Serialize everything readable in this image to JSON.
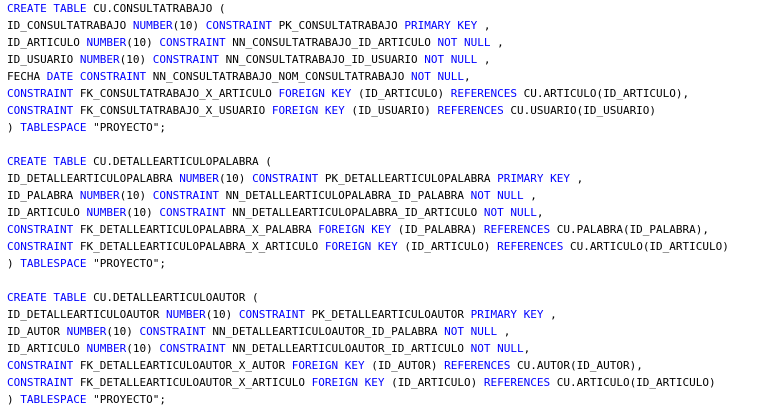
{
  "colors": {
    "background": "#ffffff",
    "keyword": "#0000ff",
    "text": "#000000"
  },
  "lines": [
    [
      {
        "k": 1,
        "t": "CREATE TABLE"
      },
      {
        "k": 0,
        "t": " CU.CONSULTATRABAJO ("
      }
    ],
    [
      {
        "k": 0,
        "t": "ID_CONSULTATRABAJO "
      },
      {
        "k": 1,
        "t": "NUMBER"
      },
      {
        "k": 0,
        "t": "(10) "
      },
      {
        "k": 1,
        "t": "CONSTRAINT"
      },
      {
        "k": 0,
        "t": " PK_CONSULTATRABAJO "
      },
      {
        "k": 1,
        "t": "PRIMARY KEY"
      },
      {
        "k": 0,
        "t": " ,"
      }
    ],
    [
      {
        "k": 0,
        "t": "ID_ARTICULO "
      },
      {
        "k": 1,
        "t": "NUMBER"
      },
      {
        "k": 0,
        "t": "(10) "
      },
      {
        "k": 1,
        "t": "CONSTRAINT"
      },
      {
        "k": 0,
        "t": " NN_CONSULTATRABAJO_ID_ARTICULO "
      },
      {
        "k": 1,
        "t": "NOT NULL"
      },
      {
        "k": 0,
        "t": " ,"
      }
    ],
    [
      {
        "k": 0,
        "t": "ID_USUARIO "
      },
      {
        "k": 1,
        "t": "NUMBER"
      },
      {
        "k": 0,
        "t": "(10) "
      },
      {
        "k": 1,
        "t": "CONSTRAINT"
      },
      {
        "k": 0,
        "t": " NN_CONSULTATRABAJO_ID_USUARIO "
      },
      {
        "k": 1,
        "t": "NOT NULL"
      },
      {
        "k": 0,
        "t": " ,"
      }
    ],
    [
      {
        "k": 0,
        "t": "FECHA "
      },
      {
        "k": 1,
        "t": "DATE CONSTRAINT"
      },
      {
        "k": 0,
        "t": " NN_CONSULTATRABAJO_NOM_CONSULTATRABAJO "
      },
      {
        "k": 1,
        "t": "NOT NULL"
      },
      {
        "k": 0,
        "t": ","
      }
    ],
    [
      {
        "k": 1,
        "t": "CONSTRAINT"
      },
      {
        "k": 0,
        "t": " FK_CONSULTATRABAJO_X_ARTICULO "
      },
      {
        "k": 1,
        "t": "FOREIGN KEY"
      },
      {
        "k": 0,
        "t": " (ID_ARTICULO) "
      },
      {
        "k": 1,
        "t": "REFERENCES"
      },
      {
        "k": 0,
        "t": " CU.ARTICULO(ID_ARTICULO),"
      }
    ],
    [
      {
        "k": 1,
        "t": "CONSTRAINT"
      },
      {
        "k": 0,
        "t": " FK_CONSULTATRABAJO_X_USUARIO "
      },
      {
        "k": 1,
        "t": "FOREIGN KEY"
      },
      {
        "k": 0,
        "t": " (ID_USUARIO) "
      },
      {
        "k": 1,
        "t": "REFERENCES"
      },
      {
        "k": 0,
        "t": " CU.USUARIO(ID_USUARIO)"
      }
    ],
    [
      {
        "k": 0,
        "t": ") "
      },
      {
        "k": 1,
        "t": "TABLESPACE"
      },
      {
        "k": 0,
        "t": " \"PROYECTO\";"
      }
    ],
    [],
    [
      {
        "k": 1,
        "t": "CREATE TABLE"
      },
      {
        "k": 0,
        "t": " CU.DETALLEARTICULOPALABRA ("
      }
    ],
    [
      {
        "k": 0,
        "t": "ID_DETALLEARTICULOPALABRA "
      },
      {
        "k": 1,
        "t": "NUMBER"
      },
      {
        "k": 0,
        "t": "(10) "
      },
      {
        "k": 1,
        "t": "CONSTRAINT"
      },
      {
        "k": 0,
        "t": " PK_DETALLEARTICULOPALABRA "
      },
      {
        "k": 1,
        "t": "PRIMARY KEY"
      },
      {
        "k": 0,
        "t": " ,"
      }
    ],
    [
      {
        "k": 0,
        "t": "ID_PALABRA "
      },
      {
        "k": 1,
        "t": "NUMBER"
      },
      {
        "k": 0,
        "t": "(10) "
      },
      {
        "k": 1,
        "t": "CONSTRAINT"
      },
      {
        "k": 0,
        "t": " NN_DETALLEARTICULOPALABRA_ID_PALABRA "
      },
      {
        "k": 1,
        "t": "NOT NULL"
      },
      {
        "k": 0,
        "t": " ,"
      }
    ],
    [
      {
        "k": 0,
        "t": "ID_ARTICULO "
      },
      {
        "k": 1,
        "t": "NUMBER"
      },
      {
        "k": 0,
        "t": "(10) "
      },
      {
        "k": 1,
        "t": "CONSTRAINT"
      },
      {
        "k": 0,
        "t": " NN_DETALLEARTICULOPALABRA_ID_ARTICULO "
      },
      {
        "k": 1,
        "t": "NOT NULL"
      },
      {
        "k": 0,
        "t": ","
      }
    ],
    [
      {
        "k": 1,
        "t": "CONSTRAINT"
      },
      {
        "k": 0,
        "t": " FK_DETALLEARTICULOPALABRA_X_PALABRA "
      },
      {
        "k": 1,
        "t": "FOREIGN KEY"
      },
      {
        "k": 0,
        "t": " (ID_PALABRA) "
      },
      {
        "k": 1,
        "t": "REFERENCES"
      },
      {
        "k": 0,
        "t": " CU.PALABRA(ID_PALABRA),"
      }
    ],
    [
      {
        "k": 1,
        "t": "CONSTRAINT"
      },
      {
        "k": 0,
        "t": " FK_DETALLEARTICULOPALABRA_X_ARTICULO "
      },
      {
        "k": 1,
        "t": "FOREIGN KEY"
      },
      {
        "k": 0,
        "t": " (ID_ARTICULO) "
      },
      {
        "k": 1,
        "t": "REFERENCES"
      },
      {
        "k": 0,
        "t": " CU.ARTICULO(ID_ARTICULO)"
      }
    ],
    [
      {
        "k": 0,
        "t": ") "
      },
      {
        "k": 1,
        "t": "TABLESPACE"
      },
      {
        "k": 0,
        "t": " \"PROYECTO\";"
      }
    ],
    [],
    [
      {
        "k": 1,
        "t": "CREATE TABLE"
      },
      {
        "k": 0,
        "t": " CU.DETALLEARTICULOAUTOR ("
      }
    ],
    [
      {
        "k": 0,
        "t": "ID_DETALLEARTICULOAUTOR "
      },
      {
        "k": 1,
        "t": "NUMBER"
      },
      {
        "k": 0,
        "t": "(10) "
      },
      {
        "k": 1,
        "t": "CONSTRAINT"
      },
      {
        "k": 0,
        "t": " PK_DETALLEARTICULOAUTOR "
      },
      {
        "k": 1,
        "t": "PRIMARY KEY"
      },
      {
        "k": 0,
        "t": " ,"
      }
    ],
    [
      {
        "k": 0,
        "t": "ID_AUTOR "
      },
      {
        "k": 1,
        "t": "NUMBER"
      },
      {
        "k": 0,
        "t": "(10) "
      },
      {
        "k": 1,
        "t": "CONSTRAINT"
      },
      {
        "k": 0,
        "t": " NN_DETALLEARTICULOAUTOR_ID_PALABRA "
      },
      {
        "k": 1,
        "t": "NOT NULL"
      },
      {
        "k": 0,
        "t": " ,"
      }
    ],
    [
      {
        "k": 0,
        "t": "ID_ARTICULO "
      },
      {
        "k": 1,
        "t": "NUMBER"
      },
      {
        "k": 0,
        "t": "(10) "
      },
      {
        "k": 1,
        "t": "CONSTRAINT"
      },
      {
        "k": 0,
        "t": " NN_DETALLEARTICULOAUTOR_ID_ARTICULO "
      },
      {
        "k": 1,
        "t": "NOT NULL"
      },
      {
        "k": 0,
        "t": ","
      }
    ],
    [
      {
        "k": 1,
        "t": "CONSTRAINT"
      },
      {
        "k": 0,
        "t": " FK_DETALLEARTICULOAUTOR_X_AUTOR "
      },
      {
        "k": 1,
        "t": "FOREIGN KEY"
      },
      {
        "k": 0,
        "t": " (ID_AUTOR) "
      },
      {
        "k": 1,
        "t": "REFERENCES"
      },
      {
        "k": 0,
        "t": " CU.AUTOR(ID_AUTOR),"
      }
    ],
    [
      {
        "k": 1,
        "t": "CONSTRAINT"
      },
      {
        "k": 0,
        "t": " FK_DETALLEARTICULOAUTOR_X_ARTICULO "
      },
      {
        "k": 1,
        "t": "FOREIGN KEY"
      },
      {
        "k": 0,
        "t": " (ID_ARTICULO) "
      },
      {
        "k": 1,
        "t": "REFERENCES"
      },
      {
        "k": 0,
        "t": " CU.ARTICULO(ID_ARTICULO)"
      }
    ],
    [
      {
        "k": 0,
        "t": ") "
      },
      {
        "k": 1,
        "t": "TABLESPACE"
      },
      {
        "k": 0,
        "t": " \"PROYECTO\";"
      }
    ]
  ]
}
